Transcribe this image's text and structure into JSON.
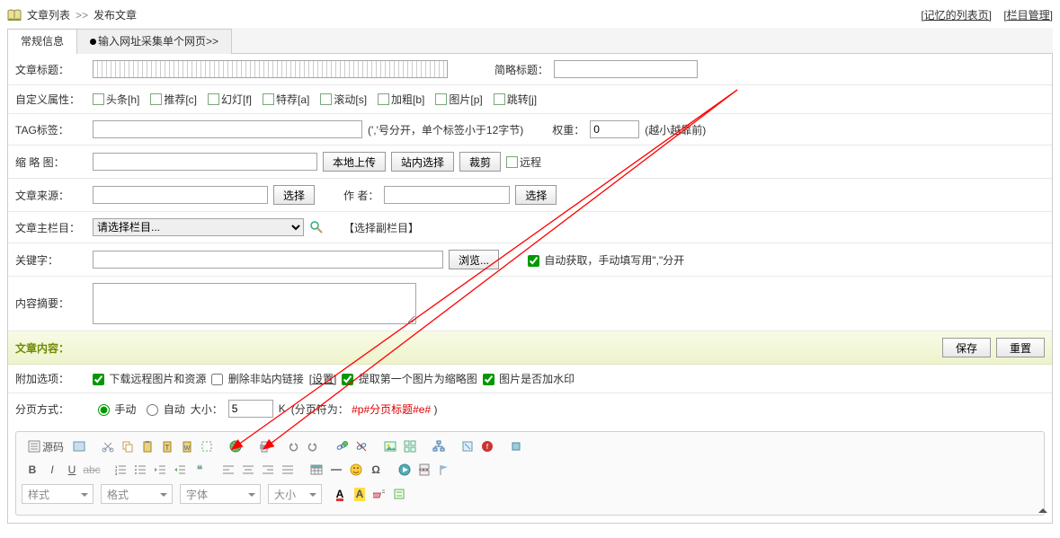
{
  "breadcrumb": {
    "list": "文章列表",
    "sep": ">>",
    "current": "发布文章"
  },
  "topLinks": {
    "memory": "[记忆的列表页]",
    "column": "[栏目管理]"
  },
  "tabs": {
    "general": "常规信息",
    "collect": "输入网址采集单个网页>>"
  },
  "fields": {
    "title": "文章标题：",
    "shortTitle": "简略标题：",
    "attrs": "自定义属性：",
    "tag": "TAG标签：",
    "tagNote": "(','号分开，单个标签小于12字节)",
    "weight": "权重：",
    "weightVal": "0",
    "weightNote": "(越小越靠前)",
    "thumb": "缩 略 图：",
    "btnLocal": "本地上传",
    "btnSite": "站内选择",
    "btnCrop": "裁剪",
    "remote": "远程",
    "source": "文章来源：",
    "btnSelect": "选择",
    "author": "作   者：",
    "mainCol": "文章主栏目：",
    "colOpt": "请选择栏目...",
    "subCol": "【选择副栏目】",
    "keywords": "关键字：",
    "btnBrowse": "浏览...",
    "autoGet": "自动获取，手动填写用\",\"分开",
    "summary": "内容摘要：",
    "content": "文章内容：",
    "save": "保存",
    "reset": "重置",
    "extra": "附加选项：",
    "dlRemote": "下载远程图片和资源",
    "delLink": "删除非站内链接",
    "setting": "[设置]",
    "firstImg": "提取第一个图片为缩略图",
    "watermark": "图片是否加水印",
    "paging": "分页方式：",
    "manual": "手动",
    "auto": "自动",
    "size": "大小：",
    "sizeVal": "5",
    "sizeUnit": "K",
    "pagingNote1": "(分页符为：",
    "pagingNote2": "#p#分页标题#e#",
    "pagingNote3": ")"
  },
  "attrs": [
    {
      "l": "头条[h]"
    },
    {
      "l": "推荐[c]"
    },
    {
      "l": "幻灯[f]"
    },
    {
      "l": "特荐[a]"
    },
    {
      "l": "滚动[s]"
    },
    {
      "l": "加粗[b]"
    },
    {
      "l": "图片[p]"
    },
    {
      "l": "跳转[j]"
    }
  ],
  "editor": {
    "source": "源码",
    "dd": {
      "style": "样式",
      "format": "格式",
      "font": "字体",
      "size": "大小"
    }
  }
}
